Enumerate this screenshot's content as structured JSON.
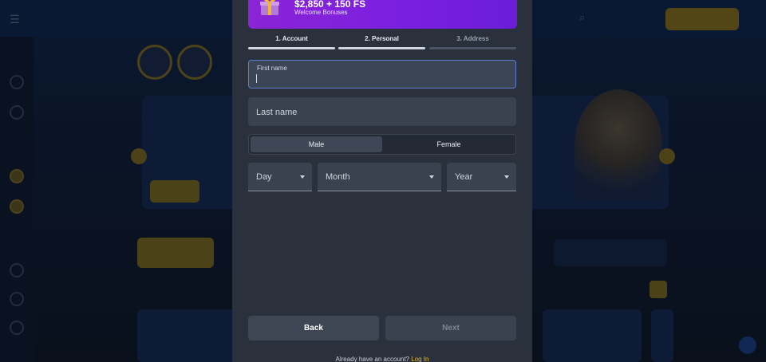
{
  "bonus": {
    "amount": "$2,850 + 150 FS",
    "label": "Welcome Bonuses",
    "icon": "gift-icon"
  },
  "steps": [
    {
      "label": "1.  Account",
      "state": "complete"
    },
    {
      "label": "2.  Personal",
      "state": "active"
    },
    {
      "label": "3.  Address",
      "state": "inactive"
    }
  ],
  "form": {
    "first_name": {
      "label": "First name",
      "value": ""
    },
    "last_name": {
      "placeholder": "Last name"
    },
    "gender": {
      "options": [
        "Male",
        "Female"
      ],
      "selected": "Male"
    },
    "day": {
      "placeholder": "Day"
    },
    "month": {
      "placeholder": "Month"
    },
    "year": {
      "placeholder": "Year"
    }
  },
  "buttons": {
    "back": "Back",
    "next": "Next"
  },
  "footer": {
    "text": "Already have an account?",
    "link": "Log In"
  },
  "colors": {
    "accent": "#e8b923",
    "bonus_purple": "#7a1fe0",
    "modal_bg": "#2a313c"
  }
}
